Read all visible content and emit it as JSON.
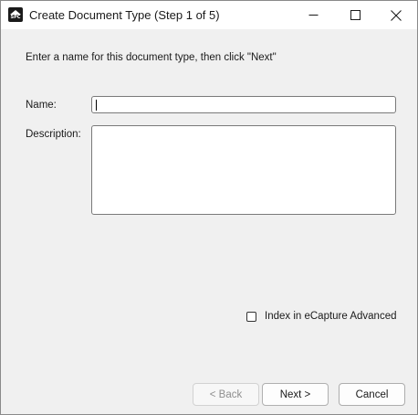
{
  "window": {
    "title": "Create Document Type (Step 1 of 5)",
    "app_icon_text": "SPC",
    "controls": [
      "minimize",
      "maximize",
      "close"
    ]
  },
  "form": {
    "instruction": "Enter a name for this document type, then click \"Next\"",
    "name_label": "Name:",
    "name_value": "",
    "description_label": "Description:",
    "description_value": "",
    "index_checkbox_label": "Index in eCapture Advanced",
    "index_checked": false
  },
  "buttons": {
    "back": "< Back",
    "next": "Next >",
    "cancel": "Cancel"
  }
}
